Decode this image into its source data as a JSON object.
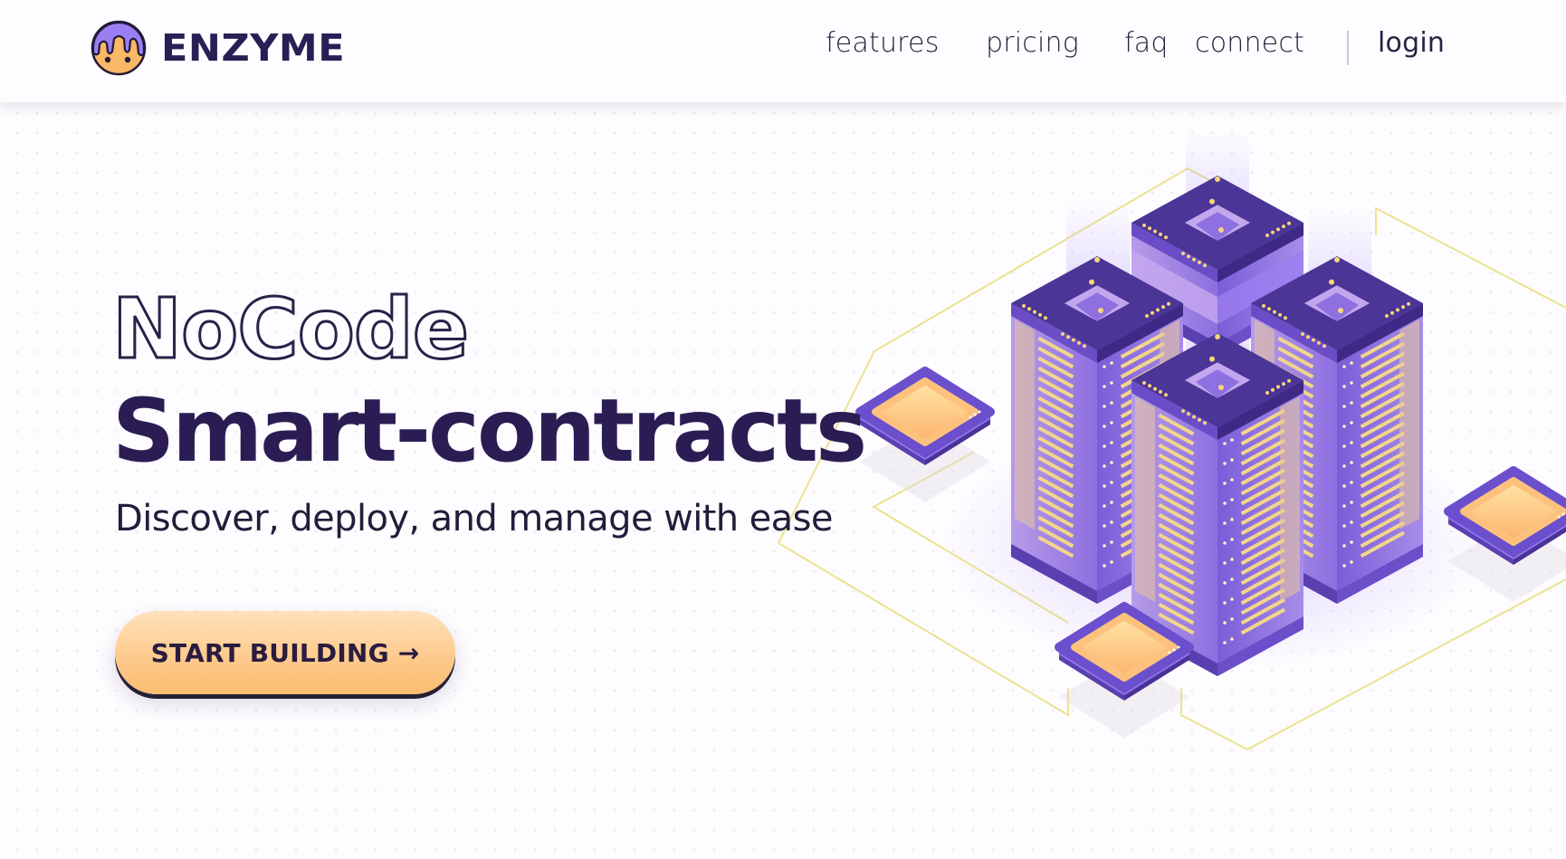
{
  "header": {
    "brand": "ENZYME",
    "logo_icon": "enzyme-mascot-icon",
    "nav": [
      {
        "label": "features"
      },
      {
        "label": "pricing"
      },
      {
        "label": "faq"
      },
      {
        "label": "connect"
      }
    ],
    "login_label": "login"
  },
  "hero": {
    "eyebrow": "NoCode",
    "title": "Smart-contracts",
    "subtitle": "Discover, deploy, and manage with ease",
    "cta_label": "START BUILDING →"
  },
  "illustration": {
    "description": "isometric server towers with chips",
    "colors": {
      "tower_top": "#4b3596",
      "tower_side": "#8a6ee6",
      "panel": "#f2d68a",
      "chip_face": "#fdc07a",
      "circuit_line": "#ece28f"
    }
  },
  "theme": {
    "text_dark": "#2b1d54",
    "button_gradient_top": "#ffe1ba",
    "button_gradient_bottom": "#fbbd70",
    "accent_purple": "#8a6ee6"
  }
}
